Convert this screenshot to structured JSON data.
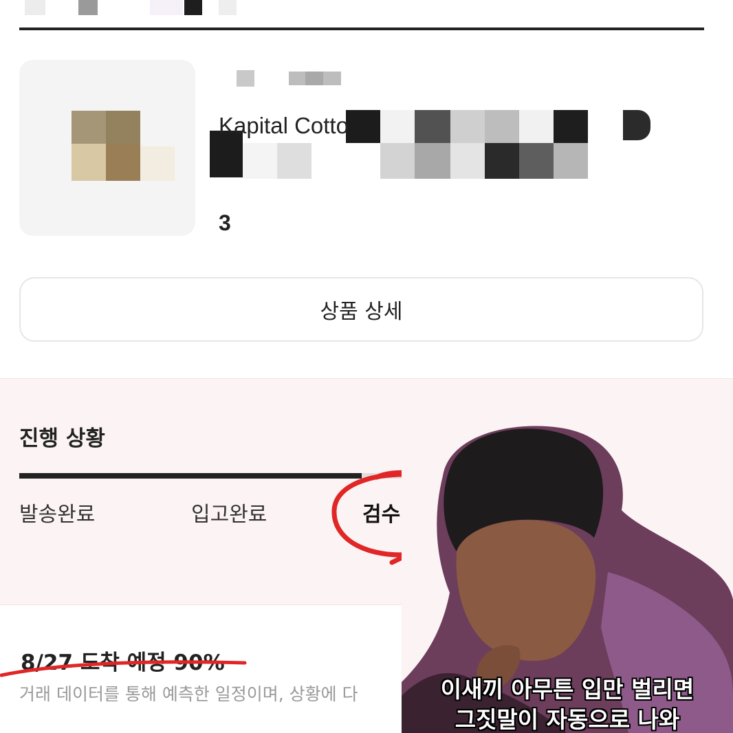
{
  "product": {
    "name": "Kapital Cotto",
    "quantity": "3"
  },
  "detail_button": {
    "label": "상품 상세"
  },
  "progress": {
    "title": "진행 상황",
    "fill_fraction": 0.5,
    "steps": [
      {
        "label": "발송완료"
      },
      {
        "label": "입고완료"
      },
      {
        "label": "검수 중"
      }
    ]
  },
  "eta": {
    "label": "8/27 도착 예정 90%",
    "note": "거래 데이터를 통해 예측한 일정이며, 상황에 다"
  },
  "meme": {
    "caption_lines": [
      "이새끼 아무튼 입만 벌리면",
      "그짓말이 자동으로 나와"
    ]
  },
  "colors": {
    "accent_dark": "#222222",
    "panel_bg": "#fcf3f4",
    "annotation_red": "#e02626"
  }
}
